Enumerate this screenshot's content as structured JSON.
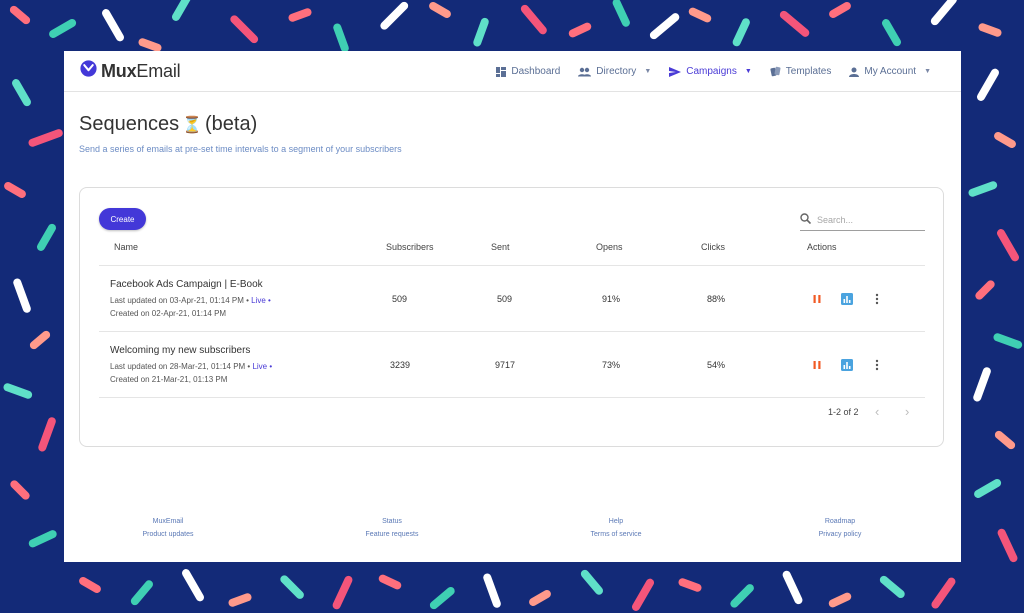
{
  "app": {
    "brand_bold": "Mux",
    "brand_rest": "Email"
  },
  "nav": [
    {
      "label": "Dashboard",
      "icon": "dashboard-icon",
      "caret": false,
      "active": false
    },
    {
      "label": "Directory",
      "icon": "people-icon",
      "caret": true,
      "active": false
    },
    {
      "label": "Campaigns",
      "icon": "send-icon",
      "caret": true,
      "active": true
    },
    {
      "label": "Templates",
      "icon": "templates-icon",
      "caret": false,
      "active": false
    },
    {
      "label": "My Account",
      "icon": "person-icon",
      "caret": true,
      "active": false
    }
  ],
  "page": {
    "title": "Sequences",
    "title_emoji": "⏳",
    "title_suffix": "(beta)",
    "subtitle": "Send a series of emails at pre-set time intervals to a segment of your subscribers"
  },
  "toolbar": {
    "create_label": "Create",
    "search_placeholder": "Search..."
  },
  "table": {
    "headers": {
      "name": "Name",
      "subscribers": "Subscribers",
      "sent": "Sent",
      "opens": "Opens",
      "clicks": "Clicks",
      "actions": "Actions"
    },
    "rows": [
      {
        "name": "Facebook Ads Campaign | E-Book",
        "updated": "Last updated on 03-Apr-21, 01:14 PM •",
        "status": "Live",
        "status_dot": "•",
        "created": "Created on 02-Apr-21, 01:14 PM",
        "subscribers": "509",
        "sent": "509",
        "opens": "91%",
        "clicks": "88%"
      },
      {
        "name": "Welcoming my new subscribers",
        "updated": "Last updated on 28-Mar-21, 01:14 PM •",
        "status": "Live",
        "status_dot": "•",
        "created": "Created on 21-Mar-21, 01:13 PM",
        "subscribers": "3239",
        "sent": "9717",
        "opens": "73%",
        "clicks": "54%"
      }
    ]
  },
  "pagination": {
    "range": "1-2 of 2"
  },
  "footer": [
    [
      "MuxEmail",
      "Product updates"
    ],
    [
      "Status",
      "Feature requests"
    ],
    [
      "Help",
      "Terms of service"
    ],
    [
      "Roadmap",
      "Privacy policy"
    ]
  ],
  "colors": {
    "accent": "#4338d8",
    "background": "#132a78",
    "pause": "#f15a24",
    "stats": "#4aa3df"
  }
}
